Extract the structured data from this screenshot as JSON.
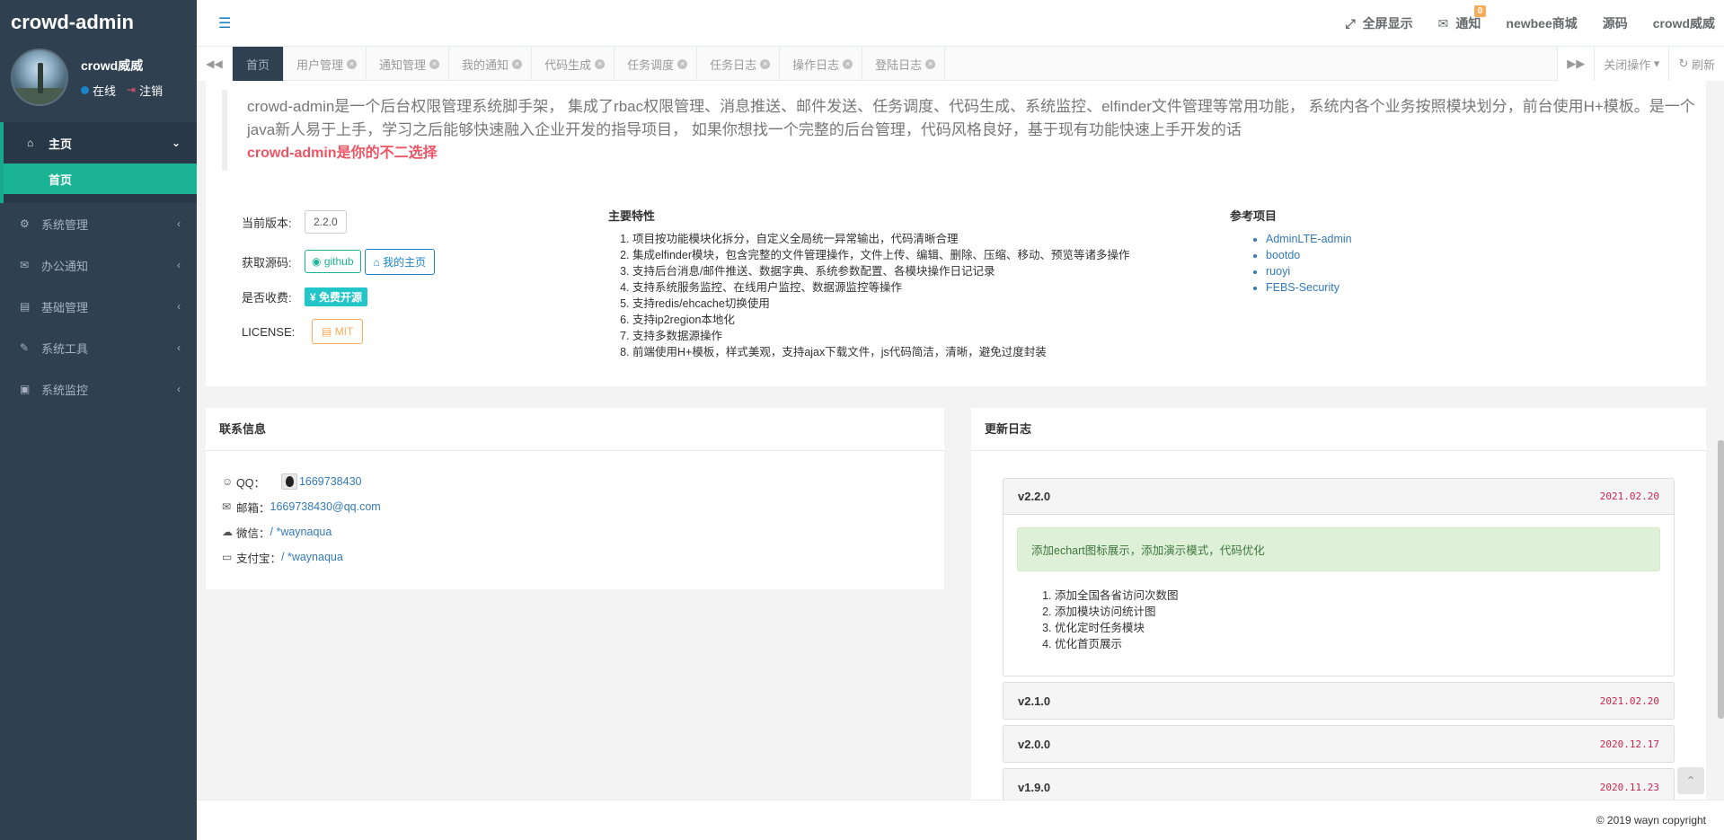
{
  "app": {
    "title": "crowd-admin"
  },
  "user": {
    "name": "crowd威威",
    "status": "在线",
    "logout": "注销"
  },
  "sidebar": {
    "items": [
      {
        "label": "主页",
        "icon": "home-icon"
      },
      {
        "label": "首页"
      },
      {
        "label": "系统管理",
        "icon": "gear-icon"
      },
      {
        "label": "办公通知",
        "icon": "envelope-icon"
      },
      {
        "label": "基础管理",
        "icon": "id-card-icon"
      },
      {
        "label": "系统工具",
        "icon": "wrench-icon"
      },
      {
        "label": "系统监控",
        "icon": "image-icon"
      }
    ]
  },
  "topnav": {
    "fullscreen": "全屏显示",
    "notice": "通知",
    "notice_count": "0",
    "mall": "newbee商城",
    "source": "源码",
    "user": "crowd威威"
  },
  "tabs": [
    "首页",
    "用户管理",
    "通知管理",
    "我的通知",
    "代码生成",
    "任务调度",
    "任务日志",
    "操作日志",
    "登陆日志"
  ],
  "tab_actions": {
    "close_ops": "关闭操作",
    "refresh": "刷新"
  },
  "intro": {
    "text": "crowd-admin是一个后台权限管理系统脚手架， 集成了rbac权限管理、消息推送、邮件发送、任务调度、代码生成、系统监控、elfinder文件管理等常用功能， 系统内各个业务按照模块划分，前台使用H+模板。是一个java新人易于上手，学习之后能够快速融入企业开发的指导项目， 如果你想找一个完整的后台管理，代码风格良好，基于现有功能快速上手开发的话",
    "highlight": "crowd-admin是你的不二选择"
  },
  "info": {
    "version_label": "当前版本:",
    "version": "2.2.0",
    "source_label": "获取源码:",
    "github": "github",
    "homepage": "我的主页",
    "fee_label": "是否收费:",
    "fee_value": "¥ 免费开源",
    "license_label": "LICENSE:",
    "license_value": "MIT"
  },
  "features": {
    "title": "主要特性",
    "items": [
      "项目按功能模块化拆分，自定义全局统一异常输出，代码清晰合理",
      "集成elfinder模块，包含完整的文件管理操作，文件上传、编辑、删除、压缩、移动、预览等诸多操作",
      "支持后台消息/邮件推送、数据字典、系统参数配置、各模块操作日记记录",
      "支持系统服务监控、在线用户监控、数据源监控等操作",
      "支持redis/ehcache切换使用",
      "支持ip2region本地化",
      "支持多数据源操作",
      "前端使用H+模板，样式美观，支持ajax下载文件，js代码简洁，清晰，避免过度封装"
    ]
  },
  "refs": {
    "title": "参考项目",
    "items": [
      "AdminLTE-admin",
      "bootdo",
      "ruoyi",
      "FEBS-Security"
    ]
  },
  "contact": {
    "title": "联系信息",
    "qq_label": "QQ：",
    "qq": "1669738430",
    "email_label": "邮箱：",
    "email": "1669738430@qq.com",
    "wechat_label": "微信：",
    "wechat": "/ *waynaqua",
    "alipay_label": "支付宝：",
    "alipay": "/ *waynaqua"
  },
  "changelog": {
    "title": "更新日志",
    "entries": [
      {
        "version": "v2.2.0",
        "date": "2021.02.20",
        "summary": "添加echart图标展示，添加演示模式，代码优化",
        "items": [
          "添加全国各省访问次数图",
          "添加模块访问统计图",
          "优化定时任务模块",
          "优化首页展示"
        ]
      },
      {
        "version": "v2.1.0",
        "date": "2021.02.20"
      },
      {
        "version": "v2.0.0",
        "date": "2020.12.17"
      },
      {
        "version": "v1.9.0",
        "date": "2020.11.23"
      }
    ]
  },
  "footer": {
    "copyright": "© 2019 wayn copyright"
  }
}
